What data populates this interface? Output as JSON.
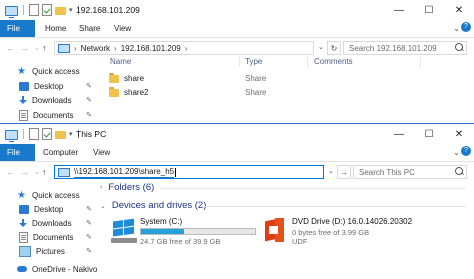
{
  "windows": [
    {
      "title": "192.168.101.209",
      "ribbon_tabs": [
        "File",
        "Home",
        "Share",
        "View"
      ],
      "address_parts": [
        "Network",
        "192.168.101.209"
      ],
      "search_placeholder": "Search 192.168.101.209",
      "columns": [
        "Name",
        "Type",
        "Comments"
      ],
      "files": [
        {
          "name": "share",
          "type": "Share"
        },
        {
          "name": "share2",
          "type": "Share"
        }
      ],
      "nav": [
        "Quick access",
        "Desktop",
        "Downloads",
        "Documents"
      ]
    },
    {
      "title": "This PC",
      "ribbon_tabs": [
        "File",
        "Computer",
        "View"
      ],
      "address_value": "\\\\192.168.101.209\\share_h5",
      "search_placeholder": "Search This PC",
      "folders_header": "Folders (6)",
      "devices_header": "Devices and drives (2)",
      "drives": [
        {
          "name": "System (C:)",
          "free": "24.7 GB free of 39.9 GB",
          "used_fraction": 0.38
        },
        {
          "name": "DVD Drive (D:) 16.0.14026.20302",
          "free": "0 bytes free of 3.99 GB",
          "fs": "UDF"
        }
      ],
      "nav": [
        "Quick access",
        "Desktop",
        "Downloads",
        "Documents",
        "Pictures",
        "OneDrive - Nakivo"
      ]
    }
  ],
  "window_controls": {
    "minimize": "—",
    "maximize": "☐",
    "close": "✕"
  },
  "icons": [
    "computer-icon",
    "page-icon",
    "check-icon",
    "folder-icon",
    "star-icon",
    "desktop-icon",
    "download-icon",
    "documents-icon",
    "pictures-icon",
    "cloud-icon",
    "windows-drive-icon",
    "office-disc-icon",
    "search-icon",
    "refresh-icon",
    "pin-icon"
  ],
  "colors": {
    "accent": "#1979ca",
    "folder": "#f0c14b",
    "drive_fill": "#26a0da",
    "group_heading": "#1e3287"
  }
}
